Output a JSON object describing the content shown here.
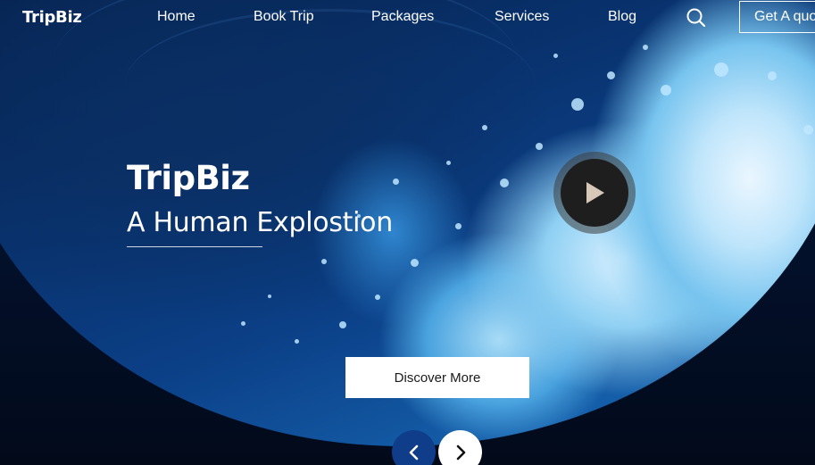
{
  "brand": {
    "logo": "TripBiz"
  },
  "nav": {
    "items": [
      {
        "label": "Home"
      },
      {
        "label": "Book Trip"
      },
      {
        "label": "Packages"
      },
      {
        "label": "Services"
      },
      {
        "label": "Blog"
      }
    ],
    "search_icon": "search-icon",
    "quote_label": "Get A quote"
  },
  "hero": {
    "title": "TripBiz",
    "subtitle": "A Human Explostion",
    "play_icon": "play-icon",
    "cta_label": "Discover More",
    "prev_icon": "chevron-left-icon",
    "next_icon": "chevron-right-icon"
  },
  "colors": {
    "background": "#020b1c",
    "accent": "#0f3d8a",
    "button": "#ffffff"
  }
}
